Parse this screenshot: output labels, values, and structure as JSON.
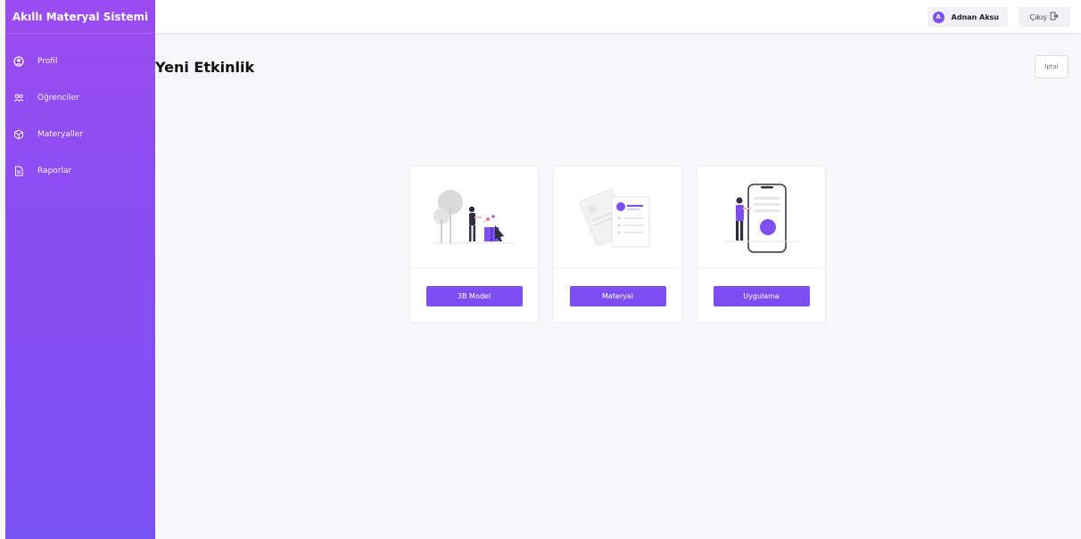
{
  "brand": "Akıllı Materyal Sistemi",
  "sidebar": {
    "items": [
      {
        "label": "Profil",
        "icon": "user-circle-icon"
      },
      {
        "label": "Öğrenciler",
        "icon": "users-icon"
      },
      {
        "label": "Materyaller",
        "icon": "cube-icon"
      },
      {
        "label": "Raporlar",
        "icon": "file-icon"
      }
    ]
  },
  "topbar": {
    "user_name": "Adnan Aksu",
    "avatar_initial": "A",
    "logout_label": "Çıkış"
  },
  "page": {
    "title": "Yeni Etkinlik",
    "cancel_label": "İptal"
  },
  "cards": [
    {
      "label": "3B Model",
      "icon": "3d-model-illustration"
    },
    {
      "label": "Materyal",
      "icon": "material-illustration"
    },
    {
      "label": "Uygulama",
      "icon": "mobile-app-illustration"
    }
  ],
  "colors": {
    "accent": "#7d4ef1",
    "sidebar_top": "#9b4cf2",
    "sidebar_bottom": "#7a51f4",
    "background": "#f6f6fb"
  }
}
